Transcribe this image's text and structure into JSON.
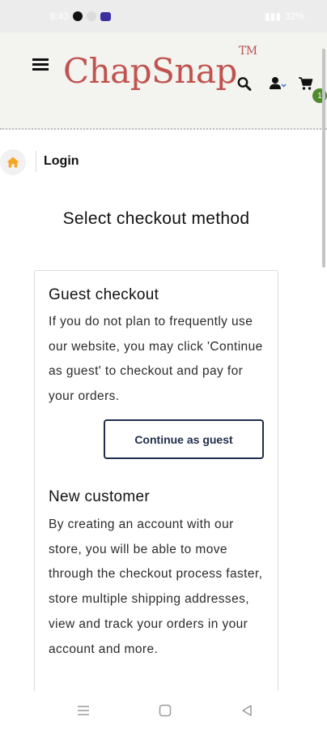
{
  "status_bar": {
    "time": "8:43",
    "battery": "32%"
  },
  "header": {
    "logo_text": "ChapSnap",
    "logo_trademark": "TM",
    "cart_count": "1"
  },
  "breadcrumb": {
    "current": "Login"
  },
  "page": {
    "title": "Select checkout method",
    "guest": {
      "title": "Guest checkout",
      "text": "If you do not plan to frequently use our website, you may click 'Continue as guest' to checkout and pay for your orders.",
      "button_label": "Continue as guest"
    },
    "new_customer": {
      "title": "New customer",
      "text": "By creating an account with our store, you will be able to move through the checkout process faster, store multiple shipping addresses, view and track your orders in your account and more."
    }
  },
  "colors": {
    "brand": "#c0534f",
    "home_icon": "#f5a623",
    "button_border": "#1f2d4d",
    "badge": "#4e8a2e"
  },
  "icons": {
    "menu": "hamburger-icon",
    "search": "search-icon",
    "account": "user-icon",
    "cart": "cart-icon",
    "home": "home-icon"
  }
}
